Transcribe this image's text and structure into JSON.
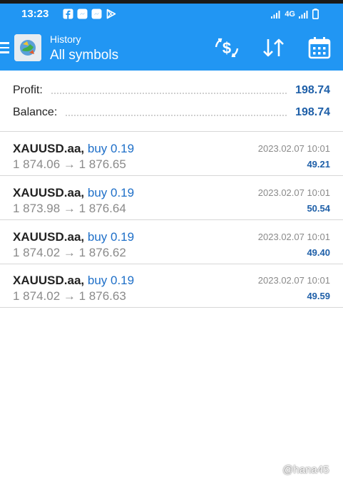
{
  "status_bar": {
    "time": "13:23",
    "network": "4G",
    "notification_icons": [
      "facebook-icon",
      "messenger-icon",
      "messenger-icon",
      "play-icon"
    ]
  },
  "app_bar": {
    "title_small": "History",
    "title_big": "All symbols",
    "actions": [
      "currency-exchange-icon",
      "sort-icon",
      "calendar-icon"
    ]
  },
  "summary": {
    "profit_label": "Profit:",
    "profit_value": "198.74",
    "balance_label": "Balance:",
    "balance_value": "198.74"
  },
  "trades": [
    {
      "symbol": "XAUUSD.aa,",
      "side": "buy 0.19",
      "prices": "1 874.06 → 1 876.65",
      "time": "2023.02.07 10:01",
      "profit": "49.21"
    },
    {
      "symbol": "XAUUSD.aa,",
      "side": "buy 0.19",
      "prices": "1 873.98 → 1 876.64",
      "time": "2023.02.07 10:01",
      "profit": "50.54"
    },
    {
      "symbol": "XAUUSD.aa,",
      "side": "buy 0.19",
      "prices": "1 874.02 → 1 876.62",
      "time": "2023.02.07 10:01",
      "profit": "49.40"
    },
    {
      "symbol": "XAUUSD.aa,",
      "side": "buy 0.19",
      "prices": "1 874.02 → 1 876.63",
      "time": "2023.02.07 10:01",
      "profit": "49.59"
    }
  ],
  "watermark": "@hana45",
  "colors": {
    "accent": "#2196f3",
    "value_blue": "#1e5fa8",
    "side_blue": "#1e6fc8",
    "muted_text": "#8a8a8a"
  }
}
